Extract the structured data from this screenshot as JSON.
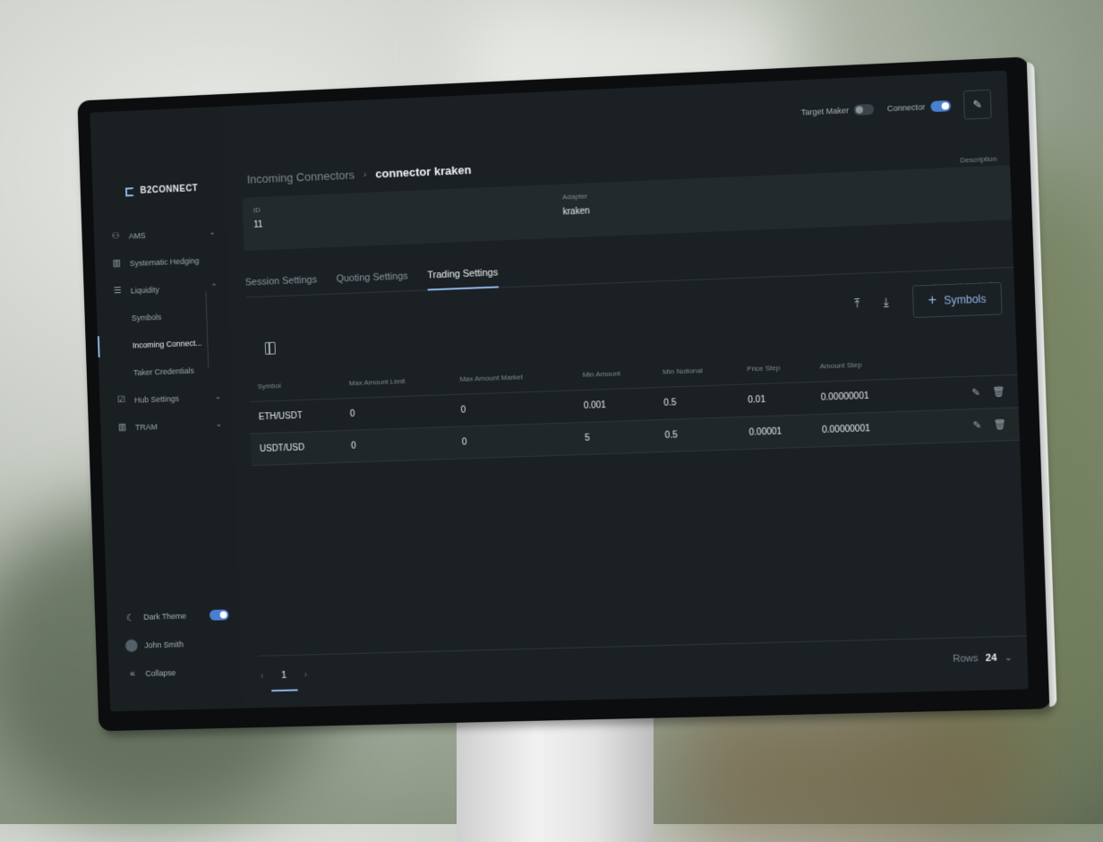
{
  "brand": {
    "name": "B2CONNECT"
  },
  "sidebar": {
    "items": [
      {
        "label": "AMS",
        "icon": "users-icon",
        "chevron": "⌄"
      },
      {
        "label": "Systematic Hedging",
        "icon": "chart-icon"
      },
      {
        "label": "Liquidity",
        "icon": "list-icon",
        "chevron": "⌃"
      },
      {
        "label": "Symbols"
      },
      {
        "label": "Incoming Connect..."
      },
      {
        "label": "Taker Credentials"
      },
      {
        "label": "Hub Settings",
        "icon": "settings-icon",
        "chevron": "⌄"
      },
      {
        "label": "TRAM",
        "icon": "chart-icon",
        "chevron": "⌄"
      }
    ],
    "bottom": {
      "theme_label": "Dark Theme",
      "user_name": "John Smith",
      "collapse_label": "Collapse"
    }
  },
  "topbar": {
    "target_maker_label": "Target Maker",
    "target_maker_on": false,
    "connector_label": "Connector",
    "connector_on": true
  },
  "breadcrumb": {
    "parent": "Incoming Connectors",
    "separator": "›",
    "current": "connector kraken"
  },
  "info": {
    "id_label": "ID",
    "id_value": "11",
    "adapter_label": "Adapter",
    "adapter_value": "kraken",
    "description_label": "Description",
    "description_value": "–"
  },
  "tabs": [
    "Session Settings",
    "Quoting Settings",
    "Trading Settings"
  ],
  "actions": {
    "add_symbols_label": "Symbols",
    "plus": "+"
  },
  "table": {
    "headers": [
      "Symbol",
      "Max Amount Limit",
      "Max Amount Market",
      "Min Amount",
      "Min Notional",
      "Price Step",
      "Amount Step"
    ],
    "rows": [
      [
        "ETH/USDT",
        "0",
        "0",
        "0.001",
        "0.5",
        "0.01",
        "0.00000001"
      ],
      [
        "USDT/USD",
        "0",
        "0",
        "5",
        "0.5",
        "0.00001",
        "0.00000001"
      ]
    ]
  },
  "pagination": {
    "page": "1",
    "prev": "‹",
    "next": "›",
    "rows_label": "Rows",
    "rows_value": "24",
    "rows_chevron": "⌄"
  },
  "colors": {
    "accent": "#8fb6e8",
    "background": "#1a2023",
    "toggle_on": "#4a7fd0"
  }
}
